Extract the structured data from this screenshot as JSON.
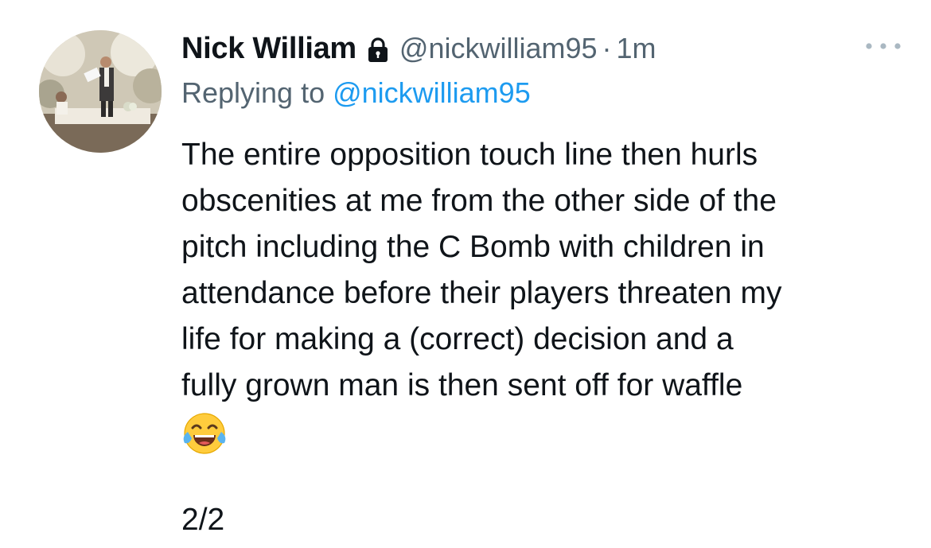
{
  "tweet": {
    "author_name": "Nick William",
    "handle": "@nickwilliam95",
    "separator": "·",
    "time": "1m",
    "locked_icon": "lock-icon",
    "more_icon": "more-horizontal-icon",
    "reply_prefix": "Replying to ",
    "reply_to": "@nickwilliam95",
    "text_lines": [
      "The entire opposition touch line then hurls",
      "obscenities at me from the other side of the",
      "pitch including the C Bomb with children in",
      "attendance before their players threaten my",
      "life for making a (correct) decision and a",
      "fully grown man is then sent off for waffle"
    ],
    "emoji": "tears-of-joy-emoji",
    "thread_counter": "2/2"
  },
  "colors": {
    "text": "#0f1419",
    "secondary": "#536471",
    "link": "#1d9bf0"
  }
}
